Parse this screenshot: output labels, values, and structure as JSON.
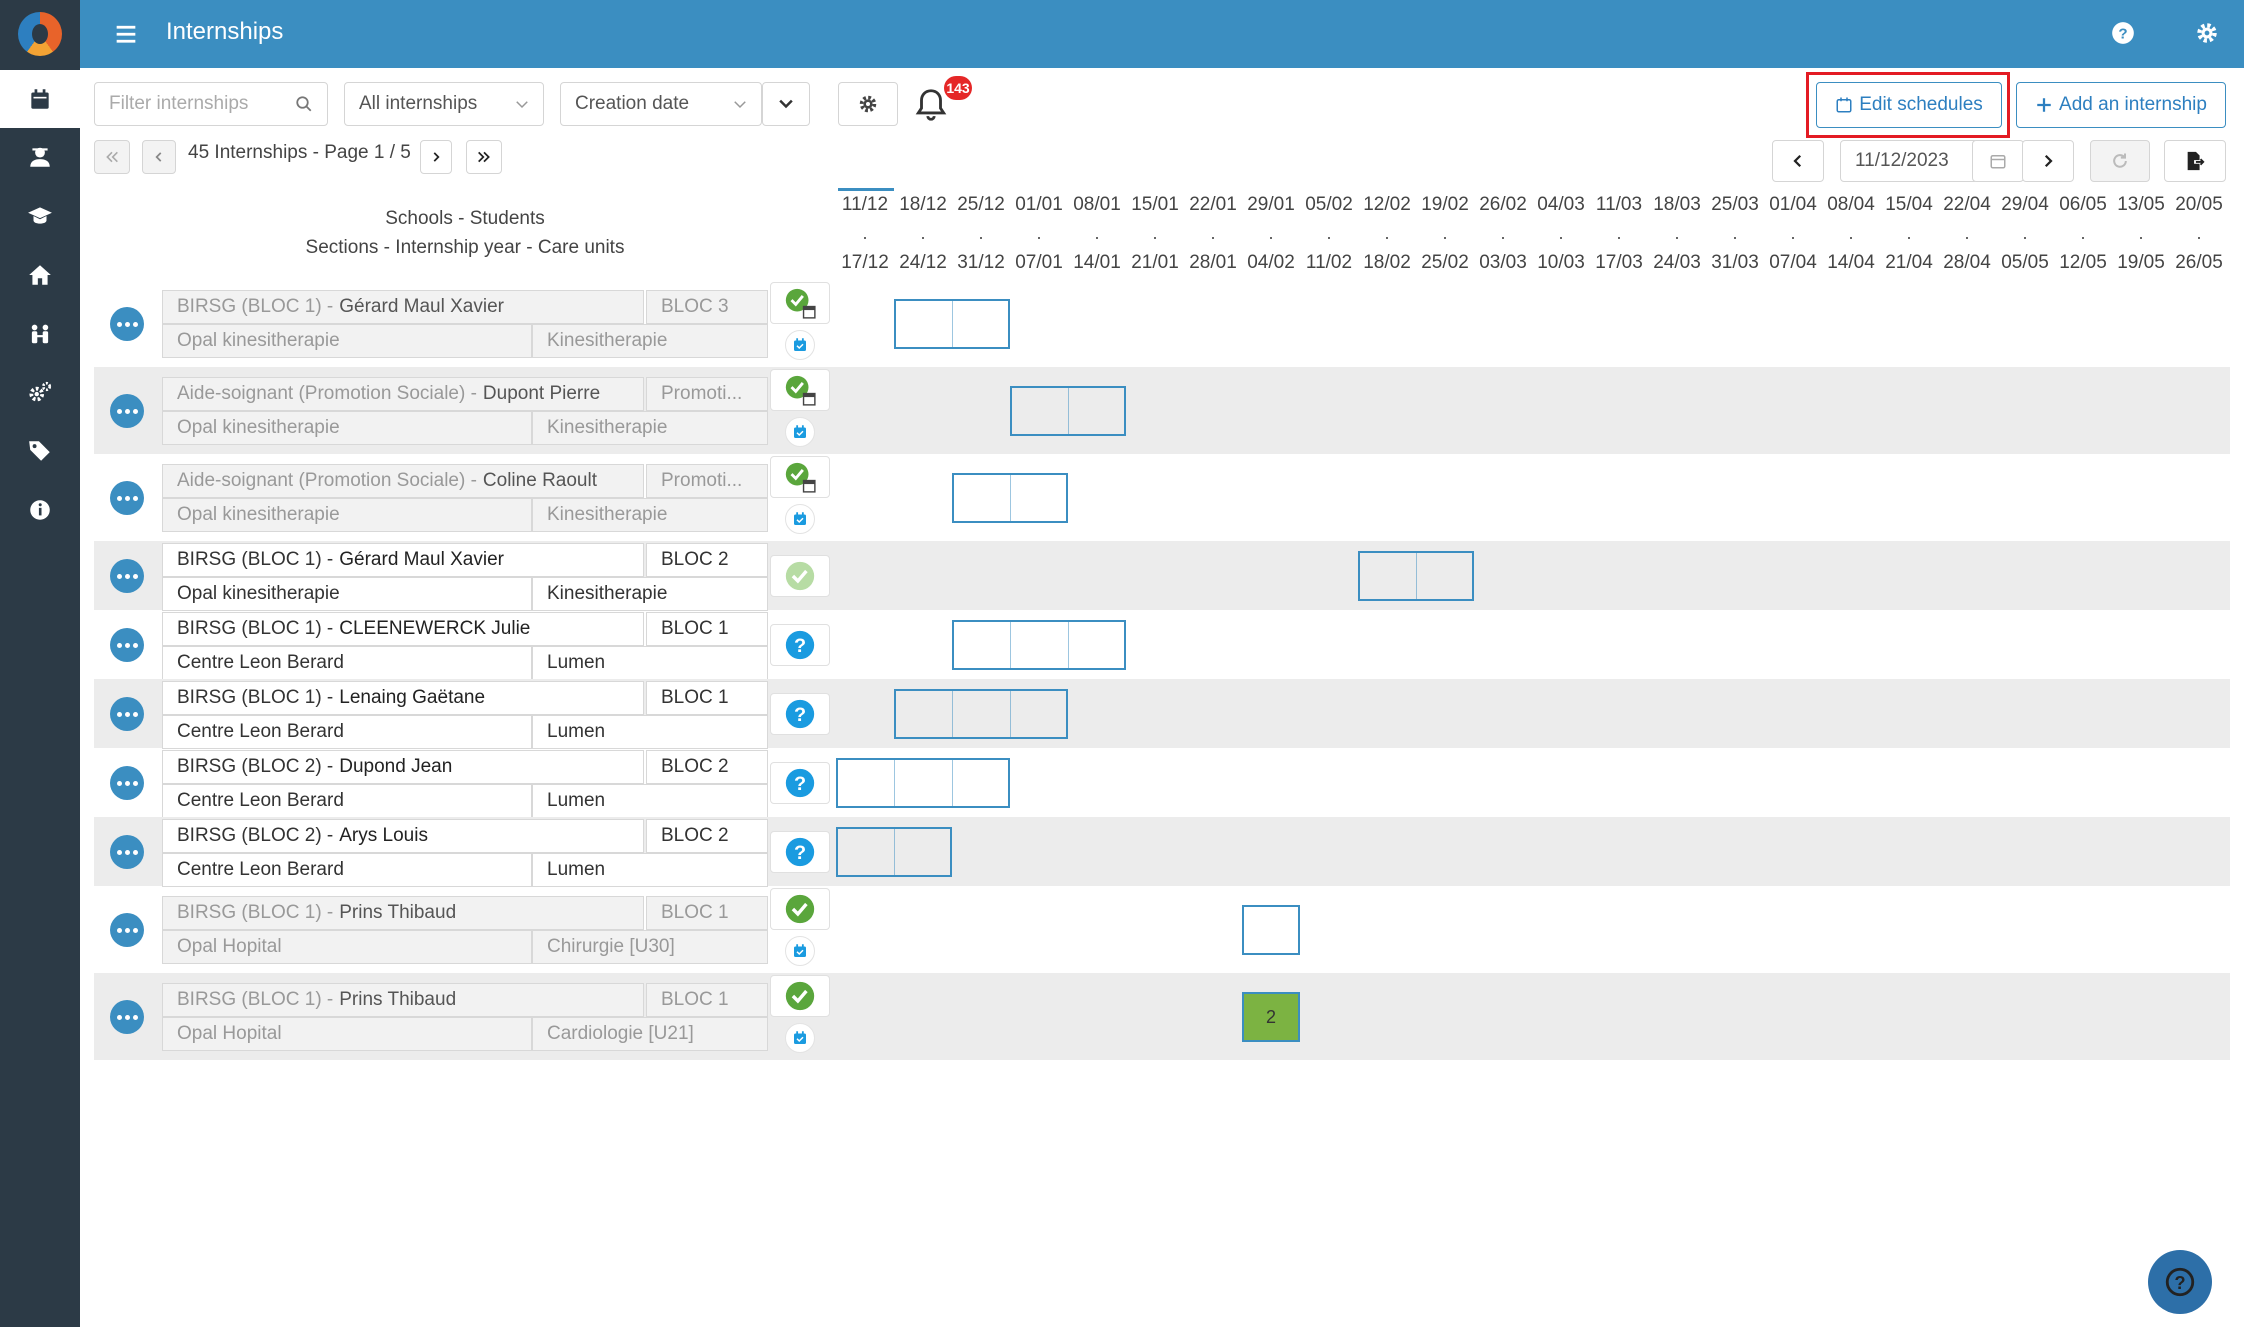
{
  "app": {
    "title": "Internships"
  },
  "sidebar": {
    "items": [
      {
        "icon": "calendar-icon",
        "active": true
      },
      {
        "icon": "student-icon"
      },
      {
        "icon": "graduation-cap-icon"
      },
      {
        "icon": "home-icon"
      },
      {
        "icon": "people-icon"
      },
      {
        "icon": "settings-cogs-icon"
      },
      {
        "icon": "tags-icon"
      },
      {
        "icon": "info-icon"
      }
    ]
  },
  "toolbar": {
    "filter_placeholder": "Filter internships",
    "type_select": "All internships",
    "sort_select": "Creation date",
    "notification_count": "143",
    "edit_schedules_label": "Edit schedules",
    "add_internship_label": "Add an internship",
    "pager_text": "45 Internships - Page 1 / 5",
    "date_value": "11/12/2023"
  },
  "grid": {
    "header_line1": "Schools - Students",
    "header_line2": "Sections - Internship year - Care units",
    "weeks_start": [
      "11/12",
      "18/12",
      "25/12",
      "01/01",
      "08/01",
      "15/01",
      "22/01",
      "29/01",
      "05/02",
      "12/02",
      "19/02",
      "26/02",
      "04/03",
      "11/03",
      "18/03",
      "25/03",
      "01/04",
      "08/04",
      "15/04",
      "22/04",
      "29/04",
      "06/05",
      "13/05",
      "20/05"
    ],
    "weeks_end": [
      "17/12",
      "24/12",
      "31/12",
      "07/01",
      "14/01",
      "21/01",
      "28/01",
      "04/02",
      "11/02",
      "18/02",
      "25/02",
      "03/03",
      "10/03",
      "17/03",
      "24/03",
      "31/03",
      "07/04",
      "14/04",
      "21/04",
      "28/04",
      "05/05",
      "12/05",
      "19/05",
      "26/05"
    ]
  },
  "rows": [
    {
      "school": "BIRSG (BLOC 1) -",
      "student": "Gérard Maul Xavier",
      "year": "BLOC 3",
      "section": "Opal kinesitherapie",
      "unit": "Kinesitherapie",
      "status": "validated-cal",
      "active": false,
      "bar_start_week": 1,
      "bar_weeks": 2
    },
    {
      "school": "Aide-soignant (Promotion Sociale) -",
      "student": "Dupont Pierre",
      "year": "Promoti...",
      "section": "Opal kinesitherapie",
      "unit": "Kinesitherapie",
      "status": "validated-cal",
      "active": false,
      "bar_start_week": 3,
      "bar_weeks": 2
    },
    {
      "school": "Aide-soignant (Promotion Sociale) -",
      "student": "Coline Raoult",
      "year": "Promoti...",
      "section": "Opal kinesitherapie",
      "unit": "Kinesitherapie",
      "status": "validated-cal",
      "active": false,
      "bar_start_week": 2,
      "bar_weeks": 2
    },
    {
      "school": "BIRSG (BLOC 1) -",
      "student": "Gérard Maul Xavier",
      "year": "BLOC 2",
      "section": "Opal kinesitherapie",
      "unit": "Kinesitherapie",
      "status": "pending-light",
      "active": true,
      "bar_start_week": 9,
      "bar_weeks": 2
    },
    {
      "school": "BIRSG (BLOC 1) -",
      "student": "CLEENEWERCK Julie",
      "year": "BLOC 1",
      "section": "Centre Leon Berard",
      "unit": "Lumen",
      "status": "question",
      "active": true,
      "bar_start_week": 2,
      "bar_weeks": 3
    },
    {
      "school": "BIRSG (BLOC 1) -",
      "student": "Lenaing Gaëtane",
      "year": "BLOC 1",
      "section": "Centre Leon Berard",
      "unit": "Lumen",
      "status": "question",
      "active": true,
      "bar_start_week": 1,
      "bar_weeks": 3
    },
    {
      "school": "BIRSG (BLOC 2) -",
      "student": "Dupond Jean",
      "year": "BLOC 2",
      "section": "Centre Leon Berard",
      "unit": "Lumen",
      "status": "question",
      "active": true,
      "bar_start_week": 0,
      "bar_weeks": 3
    },
    {
      "school": "BIRSG (BLOC 2) -",
      "student": "Arys Louis",
      "year": "BLOC 2",
      "section": "Centre Leon Berard",
      "unit": "Lumen",
      "status": "question",
      "active": true,
      "bar_start_week": 0,
      "bar_weeks": 2
    },
    {
      "school": "BIRSG (BLOC 1) -",
      "student": "Prins Thibaud",
      "year": "BLOC 1",
      "section": "Opal Hopital",
      "unit": "Chirurgie [U30]",
      "status": "validated",
      "active": false,
      "bar_start_week": 7,
      "bar_weeks": 1
    },
    {
      "school": "BIRSG (BLOC 1) -",
      "student": "Prins Thibaud",
      "year": "BLOC 1",
      "section": "Opal Hopital",
      "unit": "Cardiologie [U21]",
      "status": "validated",
      "active": false,
      "bar_start_week": 7,
      "bar_weeks": 1,
      "bar_label": "2",
      "bar_color": "#7cb342"
    }
  ]
}
